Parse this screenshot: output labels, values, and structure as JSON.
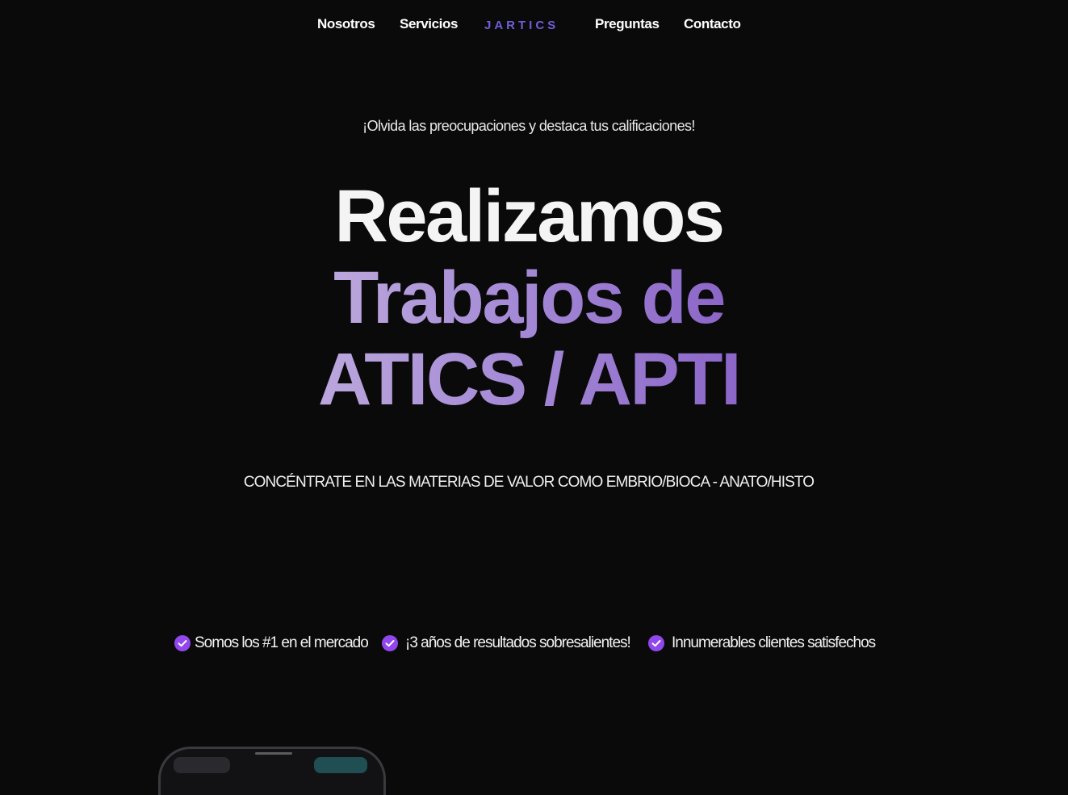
{
  "nav": {
    "items_left": [
      {
        "label": "Nosotros"
      },
      {
        "label": "Servicios"
      }
    ],
    "logo": "JARTICS",
    "items_right": [
      {
        "label": "Preguntas"
      },
      {
        "label": "Contacto"
      }
    ]
  },
  "hero": {
    "tagline": "¡Olvida las preocupaciones y destaca tus calificaciones!",
    "headline_line1": "Realizamos",
    "headline_line2": "Trabajos de",
    "headline_line3": "ATICS / APTI",
    "subheadline": "CONCÉNTRATE EN LAS MATERIAS DE VALOR COMO EMBRIO/BIOCA - ANATO/HISTO"
  },
  "features": [
    {
      "text": "Somos los #1 en el mercado",
      "icon": "check-circle-icon"
    },
    {
      "text": "¡3 años de resultados sobresalientes!",
      "icon": "check-circle-icon"
    },
    {
      "text": "Innumerables clientes satisfechos",
      "icon": "check-circle-icon"
    }
  ],
  "colors": {
    "background": "#0a0a0b",
    "accent": "#9147ec",
    "logo": "#6f5fd6",
    "gradient_start": "#bba7dc",
    "gradient_end": "#8c66c8"
  }
}
